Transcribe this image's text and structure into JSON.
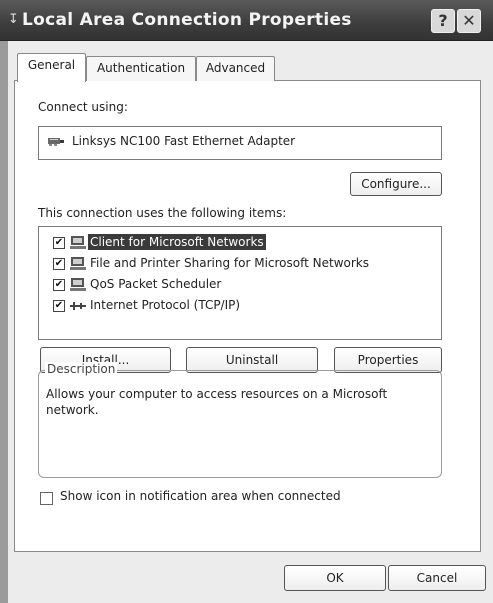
{
  "window": {
    "title": "Local Area Connection Properties",
    "help_glyph": "?",
    "close_glyph": "✕"
  },
  "tabs": [
    {
      "label": "General",
      "selected": true
    },
    {
      "label": "Authentication",
      "selected": false
    },
    {
      "label": "Advanced",
      "selected": false
    }
  ],
  "general": {
    "connect_using_label": "Connect using:",
    "adapter_name": "Linksys NC100 Fast Ethernet Adapter",
    "configure_label": "Configure...",
    "items_label": "This connection uses the following items:",
    "items": [
      {
        "label": "Client for Microsoft Networks",
        "checked": true,
        "selected": true,
        "icon": "network-client-icon"
      },
      {
        "label": "File and Printer Sharing for Microsoft Networks",
        "checked": true,
        "selected": false,
        "icon": "network-service-icon"
      },
      {
        "label": "QoS Packet Scheduler",
        "checked": true,
        "selected": false,
        "icon": "network-service-icon"
      },
      {
        "label": "Internet Protocol (TCP/IP)",
        "checked": true,
        "selected": false,
        "icon": "network-protocol-icon"
      }
    ],
    "install_label": "Install...",
    "uninstall_label": "Uninstall",
    "properties_label": "Properties",
    "description_legend": "Description",
    "description_text": "Allows your computer to access resources on a Microsoft network.",
    "show_icon_label": "Show icon in notification area when connected",
    "show_icon_checked": false
  },
  "footer": {
    "ok_label": "OK",
    "cancel_label": "Cancel"
  },
  "check_glyph": "✔"
}
